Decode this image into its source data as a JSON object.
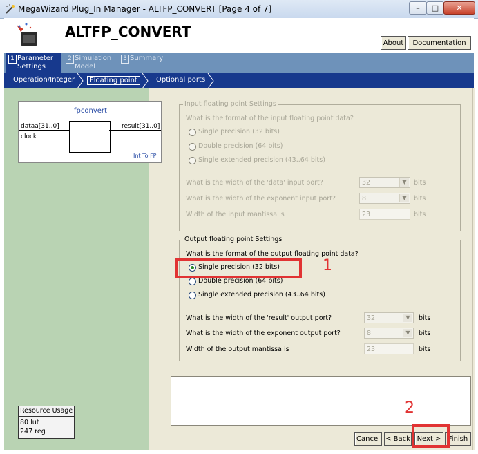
{
  "window": {
    "title": "MegaWizard Plug_In Manager - ALTFP_CONVERT [Page 4 of 7]",
    "minimize": "–",
    "maximize": "□",
    "close": "✕"
  },
  "header": {
    "title": "ALTFP_CONVERT",
    "about_label": "About",
    "documentation_label": "Documentation"
  },
  "tabs": [
    {
      "num": "1",
      "label": "Parameter Settings"
    },
    {
      "num": "2",
      "label": "Simulation Model"
    },
    {
      "num": "3",
      "label": "Summary"
    }
  ],
  "subnav": [
    "Operation/Integer",
    "Floating point",
    "Optional ports"
  ],
  "symbol": {
    "name": "fpconvert",
    "port_in1": "dataa[31..0]",
    "port_in2": "clock",
    "port_out": "result[31..0]",
    "mode": "Int To FP"
  },
  "input_group": {
    "title": "Input floating point Settings",
    "question": "What is the format of the input floating point data?",
    "options": [
      "Single precision (32 bits)",
      "Double precision (64  bits)",
      "Single extended precision (43..64 bits)"
    ],
    "data_width_q": "What is the width of the 'data' input port?",
    "data_width_val": "32",
    "exp_width_q": "What is the width of the exponent input port?",
    "exp_width_val": "8",
    "mantissa_q": "Width of the input mantissa is",
    "mantissa_val": "23",
    "unit": "bits"
  },
  "output_group": {
    "title": "Output floating point Settings",
    "question": "What is the format of the output floating point data?",
    "options": [
      "Single precision (32 bits)",
      "Double precision (64  bits)",
      "Single extended precision (43..64 bits)"
    ],
    "result_width_q": "What is the width of the 'result' output port?",
    "result_width_val": "32",
    "exp_width_q": "What is the width of the exponent output port?",
    "exp_width_val": "8",
    "mantissa_q": "Width of the output mantissa is",
    "mantissa_val": "23",
    "unit": "bits"
  },
  "resource": {
    "title": "Resource Usage",
    "line1": "80 lut",
    "line2": "247 reg"
  },
  "buttons": {
    "cancel": "Cancel",
    "back": "< Back",
    "next": "Next >",
    "finish": "Finish"
  },
  "annotations": {
    "mark1": "1",
    "mark2": "2"
  },
  "colors": {
    "accent_dark": "#17398d",
    "tab_band": "#6e92ba",
    "left_panel": "#b9d3b3",
    "highlight": "#e13333"
  }
}
